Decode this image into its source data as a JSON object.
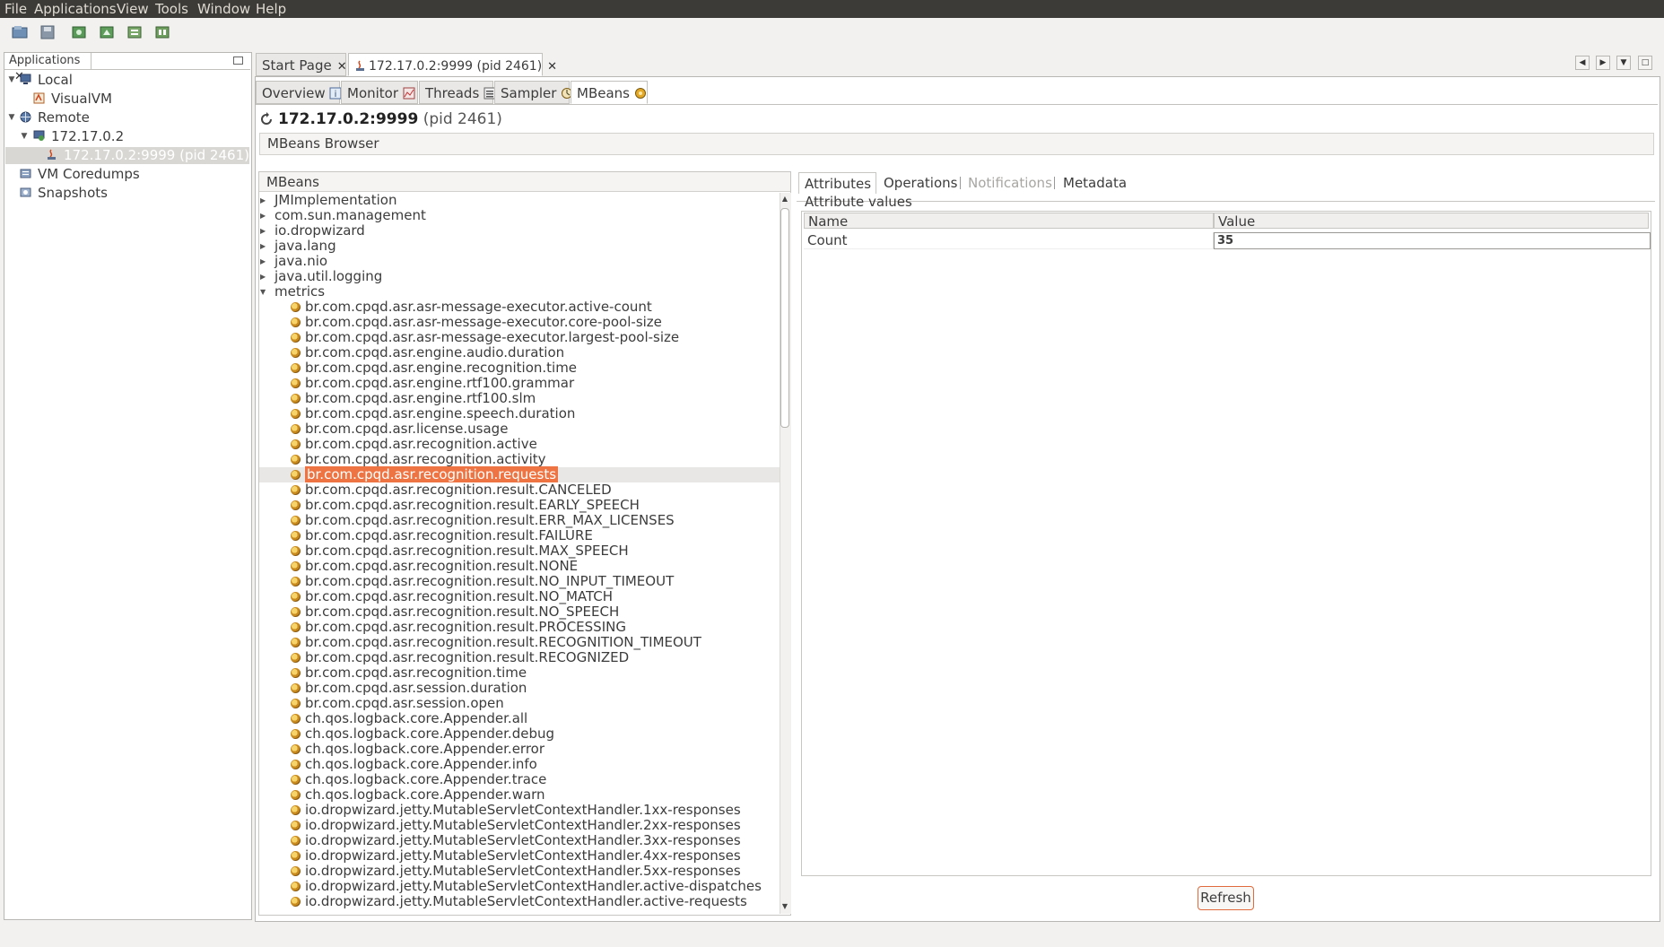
{
  "menu": [
    "File",
    "Applications",
    "View",
    "Tools",
    "Window",
    "Help"
  ],
  "apps_panel": {
    "tab_label": "Applications",
    "tree": [
      {
        "label": "Local",
        "level": 0,
        "expanded": true,
        "icon": "computer-icon"
      },
      {
        "label": "VisualVM",
        "level": 1,
        "icon": "visualvm-icon"
      },
      {
        "label": "Remote",
        "level": 0,
        "expanded": true,
        "icon": "network-icon"
      },
      {
        "label": "172.17.0.2",
        "level": 1,
        "expanded": true,
        "icon": "host-icon"
      },
      {
        "label": "172.17.0.2:9999 (pid 2461)",
        "level": 2,
        "selected": true,
        "icon": "jmx-app-icon"
      },
      {
        "label": "VM Coredumps",
        "level": 0,
        "icon": "coredump-icon"
      },
      {
        "label": "Snapshots",
        "level": 0,
        "icon": "snapshot-icon"
      }
    ]
  },
  "doc_tabs": [
    {
      "label": "Start Page",
      "active": false
    },
    {
      "label": "172.17.0.2:9999 (pid 2461)",
      "active": true
    }
  ],
  "view_tabs": [
    {
      "label": "Overview",
      "icon": "info-icon"
    },
    {
      "label": "Monitor",
      "icon": "chart-icon"
    },
    {
      "label": "Threads",
      "icon": "threads-icon"
    },
    {
      "label": "Sampler",
      "icon": "sampler-icon"
    },
    {
      "label": "MBeans",
      "icon": "mbeans-icon",
      "active": true
    }
  ],
  "app_title": {
    "host": "172.17.0.2:9999",
    "pid": "(pid 2461)"
  },
  "section_title": "MBeans Browser",
  "mbeans": {
    "header": "MBeans",
    "domains": [
      "JMImplementation",
      "com.sun.management",
      "io.dropwizard",
      "java.lang",
      "java.nio",
      "java.util.logging"
    ],
    "expanded_domain": "metrics",
    "selected": "br.com.cpqd.asr.recognition.requests",
    "items": [
      "br.com.cpqd.asr.asr-message-executor.active-count",
      "br.com.cpqd.asr.asr-message-executor.core-pool-size",
      "br.com.cpqd.asr.asr-message-executor.largest-pool-size",
      "br.com.cpqd.asr.engine.audio.duration",
      "br.com.cpqd.asr.engine.recognition.time",
      "br.com.cpqd.asr.engine.rtf100.grammar",
      "br.com.cpqd.asr.engine.rtf100.slm",
      "br.com.cpqd.asr.engine.speech.duration",
      "br.com.cpqd.asr.license.usage",
      "br.com.cpqd.asr.recognition.active",
      "br.com.cpqd.asr.recognition.activity",
      "br.com.cpqd.asr.recognition.requests",
      "br.com.cpqd.asr.recognition.result.CANCELED",
      "br.com.cpqd.asr.recognition.result.EARLY_SPEECH",
      "br.com.cpqd.asr.recognition.result.ERR_MAX_LICENSES",
      "br.com.cpqd.asr.recognition.result.FAILURE",
      "br.com.cpqd.asr.recognition.result.MAX_SPEECH",
      "br.com.cpqd.asr.recognition.result.NONE",
      "br.com.cpqd.asr.recognition.result.NO_INPUT_TIMEOUT",
      "br.com.cpqd.asr.recognition.result.NO_MATCH",
      "br.com.cpqd.asr.recognition.result.NO_SPEECH",
      "br.com.cpqd.asr.recognition.result.PROCESSING",
      "br.com.cpqd.asr.recognition.result.RECOGNITION_TIMEOUT",
      "br.com.cpqd.asr.recognition.result.RECOGNIZED",
      "br.com.cpqd.asr.recognition.time",
      "br.com.cpqd.asr.session.duration",
      "br.com.cpqd.asr.session.open",
      "ch.qos.logback.core.Appender.all",
      "ch.qos.logback.core.Appender.debug",
      "ch.qos.logback.core.Appender.error",
      "ch.qos.logback.core.Appender.info",
      "ch.qos.logback.core.Appender.trace",
      "ch.qos.logback.core.Appender.warn",
      "io.dropwizard.jetty.MutableServletContextHandler.1xx-responses",
      "io.dropwizard.jetty.MutableServletContextHandler.2xx-responses",
      "io.dropwizard.jetty.MutableServletContextHandler.3xx-responses",
      "io.dropwizard.jetty.MutableServletContextHandler.4xx-responses",
      "io.dropwizard.jetty.MutableServletContextHandler.5xx-responses",
      "io.dropwizard.jetty.MutableServletContextHandler.active-dispatches",
      "io.dropwizard.jetty.MutableServletContextHandler.active-requests"
    ]
  },
  "detail": {
    "tabs": [
      {
        "label": "Attributes",
        "active": true,
        "enabled": true
      },
      {
        "label": "Operations",
        "enabled": true
      },
      {
        "label": "Notifications",
        "enabled": false
      },
      {
        "label": "Metadata",
        "enabled": true
      }
    ],
    "caption": "Attribute values",
    "columns": [
      "Name",
      "Value"
    ],
    "rows": [
      {
        "name": "Count",
        "value": "35"
      }
    ],
    "refresh_label": "Refresh"
  },
  "colors": {
    "selection": "#ee7543",
    "menubar": "#3c3b37"
  }
}
